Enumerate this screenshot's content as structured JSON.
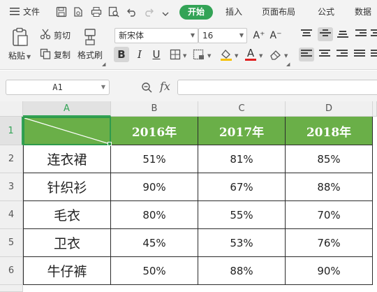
{
  "menubar": {
    "menu_label": "文件",
    "tabs": [
      "开始",
      "插入",
      "页面布局",
      "公式",
      "数据"
    ]
  },
  "ribbon": {
    "paste_label": "粘贴",
    "cut_label": "剪切",
    "copy_label": "复制",
    "format_painter_label": "格式刷",
    "font_name": "新宋体",
    "font_size": "16",
    "bold": "B",
    "italic": "I",
    "underline": "U",
    "grow_font": "A⁺",
    "shrink_font": "A⁻",
    "font_color_glyph": "A"
  },
  "formula_bar": {
    "cell_ref": "A1",
    "fx": "fx",
    "formula": ""
  },
  "sheet": {
    "columns": [
      "A",
      "B",
      "C",
      "D"
    ],
    "rows": [
      "1",
      "2",
      "3",
      "4",
      "5",
      "6"
    ],
    "header_years": [
      "2016年",
      "2017年",
      "2018年"
    ],
    "data_rows": [
      {
        "item": "连衣裙",
        "values": [
          "51%",
          "81%",
          "85%"
        ]
      },
      {
        "item": "针织衫",
        "values": [
          "90%",
          "67%",
          "88%"
        ]
      },
      {
        "item": "毛衣",
        "values": [
          "80%",
          "55%",
          "70%"
        ]
      },
      {
        "item": "卫衣",
        "values": [
          "45%",
          "53%",
          "76%"
        ]
      },
      {
        "item": "牛仔裤",
        "values": [
          "50%",
          "88%",
          "90%"
        ]
      }
    ]
  },
  "colors": {
    "accent": "#33a356",
    "header_fill": "#6aaf48",
    "header_text": "#ffffff"
  }
}
